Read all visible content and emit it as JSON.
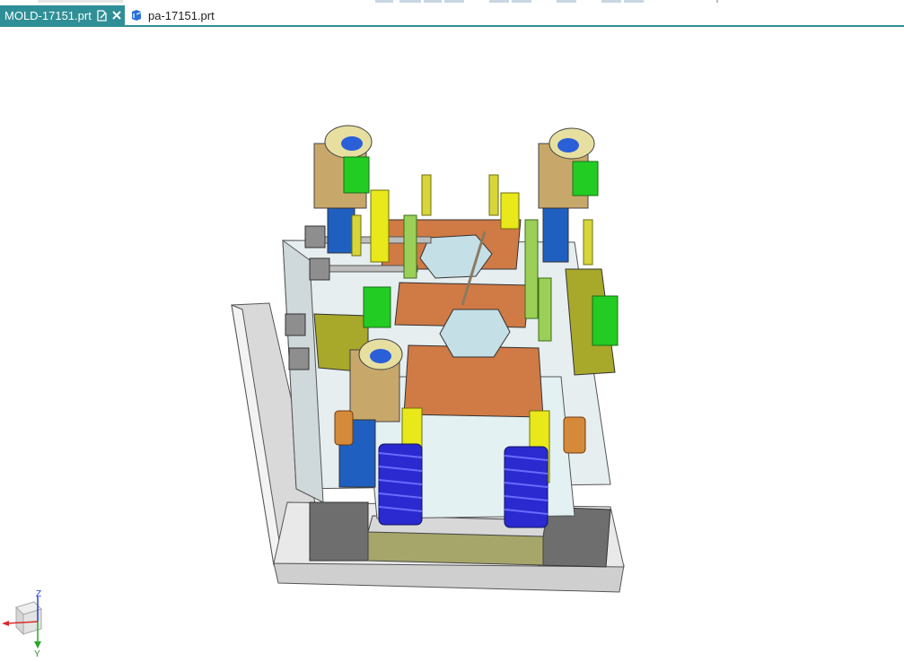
{
  "tabs": [
    {
      "label": "MOLD-17151.prt",
      "active": true,
      "modified_icon": "document-modified-icon",
      "close_icon": "close-icon"
    },
    {
      "label": "pa-17151.prt",
      "active": false,
      "icon": "part-file-icon"
    }
  ],
  "triad": {
    "z_label": "Z",
    "y_label": "Y"
  },
  "colors": {
    "tab_active": "#2f8f96",
    "plate_gray": "#d9d9d9",
    "plate_dark": "#6e6e6e",
    "copper": "#d07a45",
    "green": "#22cc22",
    "light_green": "#9ccf57",
    "yellow": "#e8e81a",
    "tan": "#c8a86a",
    "blue": "#1f5fbf",
    "spring": "#2a2ad0",
    "olive": "#a8a82a"
  }
}
